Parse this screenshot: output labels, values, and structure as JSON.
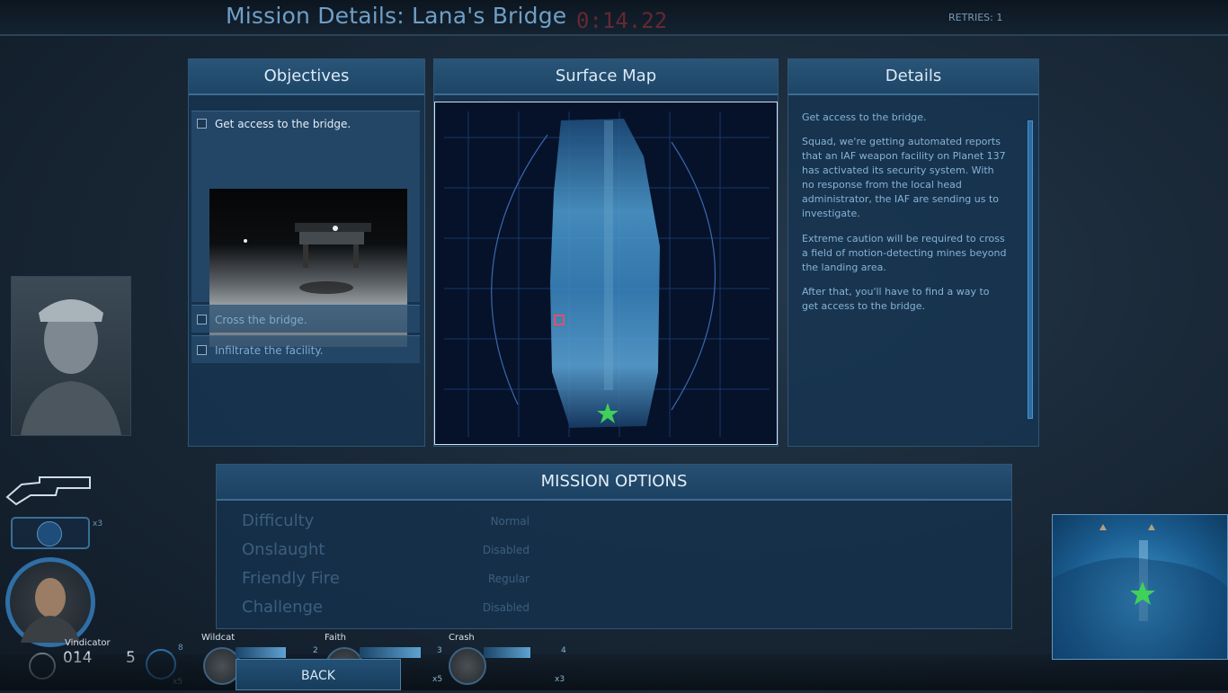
{
  "header": {
    "title": "Mission Details: Lana's Bridge",
    "timer": "0:14.22",
    "retries": "RETRIES: 1"
  },
  "objectives": {
    "heading": "Objectives",
    "items": [
      {
        "label": "Get access to the bridge."
      },
      {
        "label": "Cross the bridge."
      },
      {
        "label": "Infiltrate the facility."
      }
    ]
  },
  "surface_map": {
    "heading": "Surface Map"
  },
  "details": {
    "heading": "Details",
    "paragraphs": [
      "Get access to the bridge.",
      "Squad, we're getting automated reports that an IAF weapon facility on Planet 137 has activated its security system. With no response from the local head administrator, the IAF are sending us to investigate.",
      "Extreme caution will be required to cross a field of motion-detecting mines beyond the landing area.",
      "After that, you'll have to find a way to get access to the bridge."
    ]
  },
  "mission_options": {
    "heading": "MISSION OPTIONS",
    "rows": [
      {
        "label": "Difficulty",
        "value": "Normal"
      },
      {
        "label": "Onslaught",
        "value": "Disabled"
      },
      {
        "label": "Friendly Fire",
        "value": "Regular"
      },
      {
        "label": "Challenge",
        "value": "Disabled"
      }
    ]
  },
  "hud": {
    "player_name": "Vindicator",
    "ammo": "014",
    "grenades": "5",
    "ammo_mult": "x3",
    "ability_count": "8",
    "ability_mult": "x5",
    "team": [
      {
        "name": "Wildcat",
        "count": "2",
        "mult": ""
      },
      {
        "name": "Faith",
        "count": "3",
        "mult": "x5"
      },
      {
        "name": "Crash",
        "count": "4",
        "mult": "x3"
      }
    ],
    "team_health": [
      0.62,
      0.75,
      0.58
    ]
  },
  "back_button": "BACK",
  "colors": {
    "accent": "#2f6fa5",
    "panel": "#163452",
    "objective_marker": "#e0506a",
    "player_marker": "#3fd15a"
  }
}
